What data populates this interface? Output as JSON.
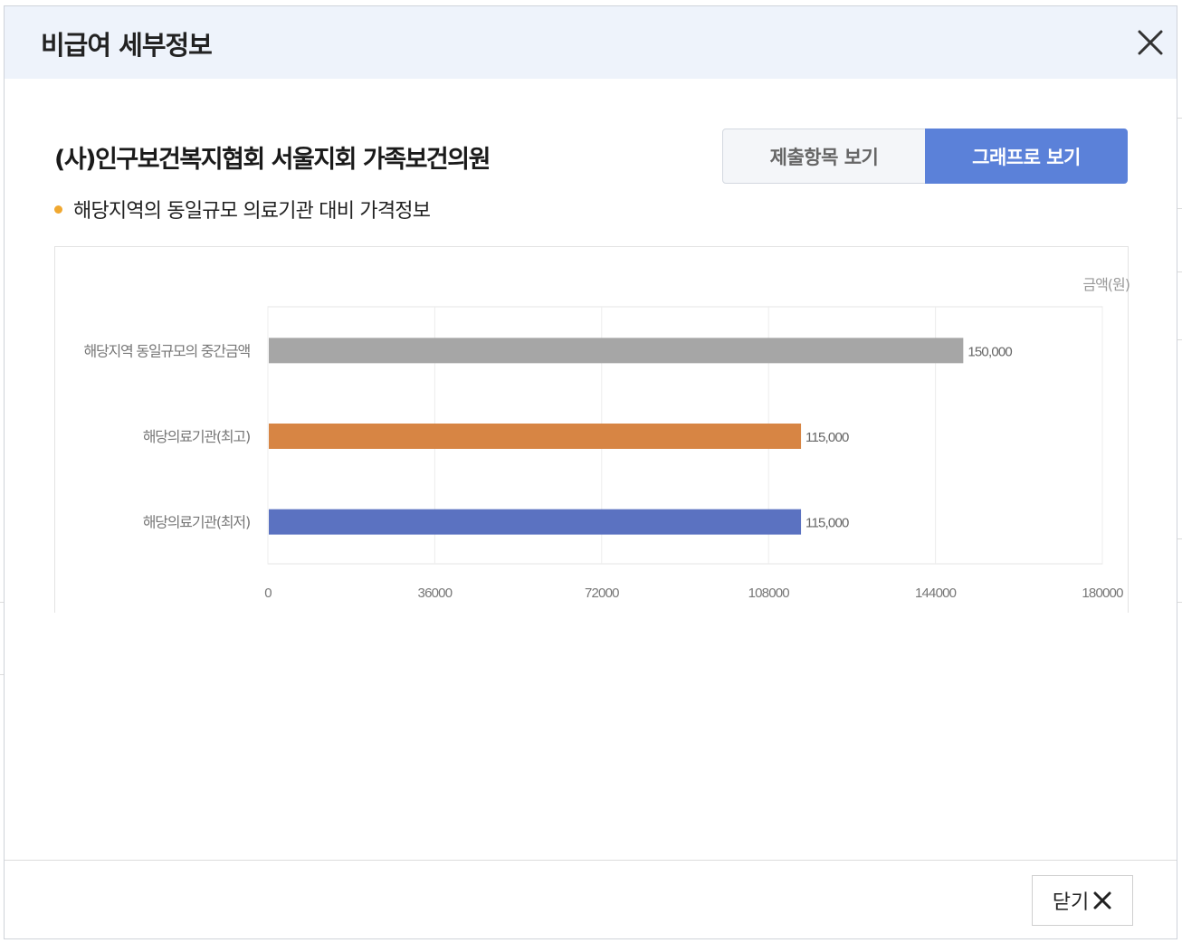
{
  "modal": {
    "title": "비급여 세부정보",
    "close_icon": "close-icon"
  },
  "clinic": {
    "name": "(사)인구보건복지협회 서울지회 가족보건의원"
  },
  "view_toggle": {
    "list_label": "제출항목 보기",
    "graph_label": "그래프로 보기",
    "active": "graph"
  },
  "section": {
    "subtitle": "해당지역의 동일규모 의료기관 대비 가격정보",
    "bullet_color": "#f0a830"
  },
  "chart_data": {
    "type": "bar",
    "orientation": "horizontal",
    "unit_label": "금액(원)",
    "categories": [
      "해당지역 동일규모의 중간금액",
      "해당의료기관(최고)",
      "해당의료기관(최저)"
    ],
    "values": [
      150000,
      115000,
      115000
    ],
    "value_labels": [
      "150,000",
      "115,000",
      "115,000"
    ],
    "colors": [
      "#a6a6a6",
      "#d78544",
      "#5b72c1"
    ],
    "xlim": [
      0,
      180000
    ],
    "xticks": [
      "0",
      "36000",
      "72000",
      "108000",
      "144000",
      "180000"
    ],
    "xtick_values": [
      0,
      36000,
      72000,
      108000,
      144000,
      180000
    ],
    "grid": true,
    "legend": "none"
  },
  "footer": {
    "close_label": "닫기"
  },
  "colors": {
    "header_bg": "#eef3fb",
    "accent": "#5b81d9"
  }
}
